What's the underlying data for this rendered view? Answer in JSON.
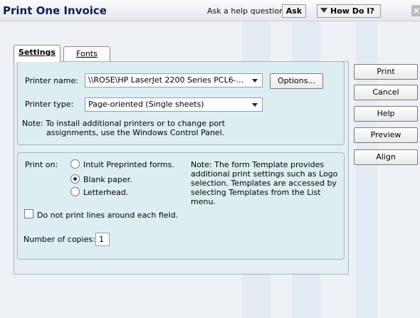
{
  "window": {
    "title": "Print One Invoice",
    "help_prompt": "Ask a help question",
    "ask_label": "Ask",
    "howdoi_label": "How Do I?"
  },
  "tabs": [
    {
      "label": "Settings",
      "active": true
    },
    {
      "label": "Fonts",
      "active": false
    }
  ],
  "printer": {
    "name_label": "Printer name:",
    "name_value": "\\\\ROSE\\HP LaserJet 2200 Series PCL6-...",
    "options_label": "Options...",
    "type_label": "Printer type:",
    "type_value": "Page-oriented (Single sheets)",
    "note_line1": "Note: To install additional printers or to change port",
    "note_line2": "assignments, use the Windows Control Panel."
  },
  "print_on": {
    "label": "Print on:",
    "options": [
      {
        "label": "Intuit Preprinted forms.",
        "selected": false
      },
      {
        "label": "Blank paper.",
        "selected": true
      },
      {
        "label": "Letterhead.",
        "selected": false
      }
    ],
    "note": [
      "Note: The form Template provides",
      "additional print settings such as Logo",
      "selection.  Templates are accessed by",
      "selecting Templates from the List",
      "menu."
    ],
    "no_lines_label": "Do not print lines around each field.",
    "no_lines_checked": false,
    "copies_label": "Number of copies:",
    "copies_value": "1"
  },
  "side_buttons": [
    {
      "label": "Print"
    },
    {
      "label": "Cancel"
    },
    {
      "label": "Help"
    },
    {
      "label": "Preview"
    },
    {
      "label": "Align"
    }
  ]
}
